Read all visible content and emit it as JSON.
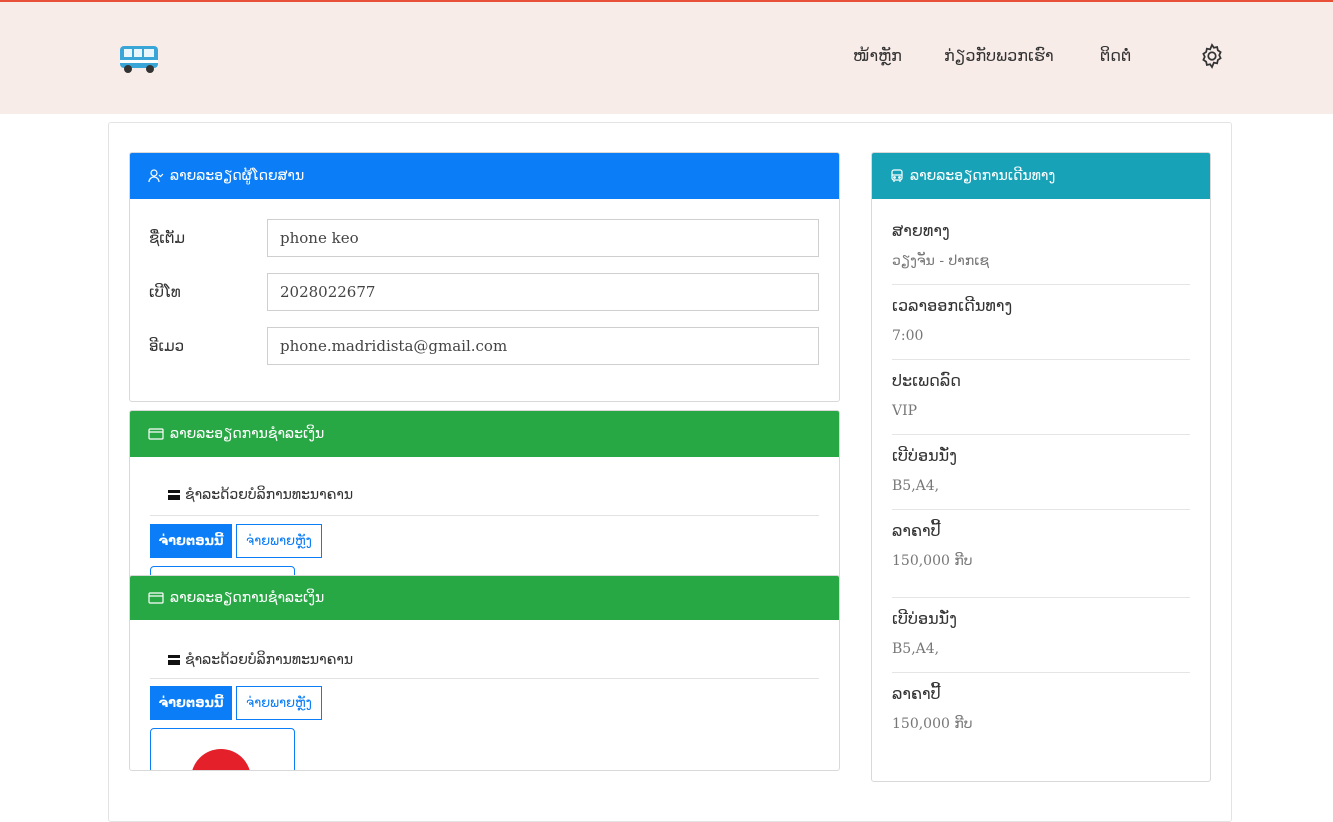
{
  "nav": {
    "logo_icon": "bus-icon",
    "items": [
      "ໜ້າຫຼັກ",
      "ກ່ຽວກັບພວກເຮົາ",
      "ຕິດຕໍ່"
    ],
    "settings_icon": "gear-icon"
  },
  "passenger": {
    "title": "ລາຍລະອຽດຜູ້ໂດຍສານ",
    "fields": [
      {
        "label": "ຊື່ເຕັມ",
        "value": "phone keo"
      },
      {
        "label": "ເບີໂທ",
        "value": "2028022677"
      },
      {
        "label": "ອີເມວ",
        "value": "phone.madridista@gmail.com"
      }
    ]
  },
  "payment": {
    "title": "ລາຍລະອຽດການຊຳລະເງິນ",
    "bank_text": "ຊຳລະດ້ວຍບໍລິການທະນາຄານ",
    "pay_now": "ຈ່າຍຕອນນີ້",
    "pay_later": "ຈ່າຍພາຍຫຼັງ"
  },
  "trip": {
    "title": "ລາຍລະອຽດການເດີນທາງ",
    "items": [
      {
        "label": "ສາຍທາງ",
        "value": "ວຽງຈັນ - ປາກເຊ"
      },
      {
        "label": "ເວລາອອກເດີນທາງ",
        "value": "7:00"
      },
      {
        "label": "ປະເພດລົດ",
        "value": "VIP"
      },
      {
        "label": "ເບີບ່ອນນັ່ງ",
        "value": "B5,A4,"
      },
      {
        "label": "ລາຄາປີ້",
        "value": "150,000 ກີບ"
      },
      {
        "label": "ເບີບ່ອນນັ່ງ",
        "value": "B5,A4,"
      },
      {
        "label": "ລາຄາປີ້",
        "value": "150,000 ກີບ"
      }
    ]
  },
  "colors": {
    "primary": "#0a7df7",
    "success": "#28a745",
    "info": "#17a2b8",
    "nav_bg": "#f8ece9"
  }
}
